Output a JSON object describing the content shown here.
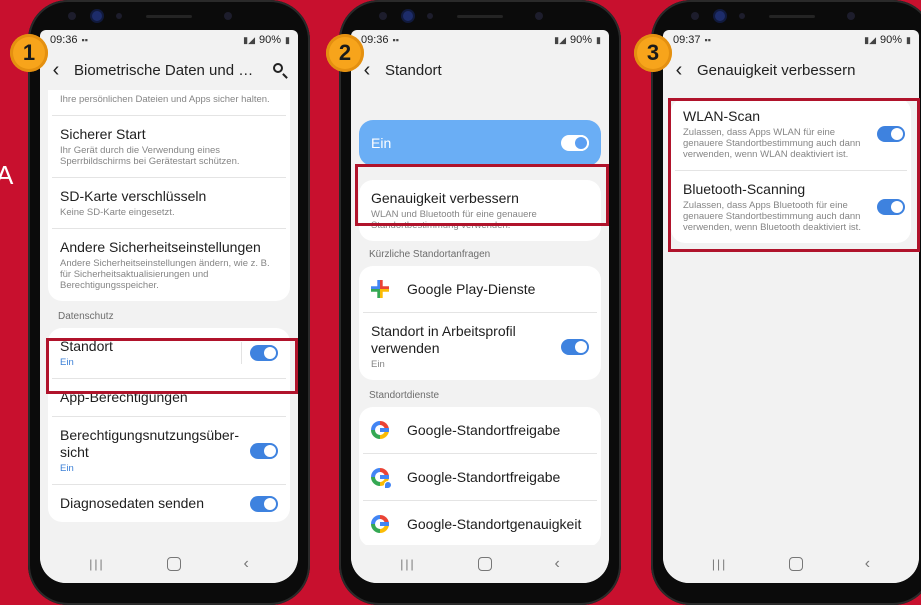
{
  "phones": [
    {
      "badge": "1",
      "status": {
        "time": "09:36",
        "battery": "90%"
      },
      "appbar": {
        "title": "Biometrische Daten und Sich…"
      },
      "partial_text": "Ihre persönlichen Dateien und Apps sicher halten.",
      "card1": [
        {
          "title": "Sicherer Start",
          "sub": "Ihr Gerät durch die Verwendung eines Sperrbildschirms bei Gerätestart schützen."
        },
        {
          "title": "SD-Karte verschlüsseln",
          "sub": "Keine SD-Karte eingesetzt."
        },
        {
          "title": "Andere Sicherheitseinstellungen",
          "sub": "Andere Sicherheitseinstellungen ändern, wie z. B. für Sicherheitsaktualisierungen und Berechtigungsspeicher."
        }
      ],
      "section": "Datenschutz",
      "card2": [
        {
          "title": "Standort",
          "sub": "Ein",
          "toggle": true
        },
        {
          "title": "App-Berechtigungen"
        },
        {
          "title": "Berechtigungsnutzungsüber-sicht",
          "sub": "Ein",
          "toggle": true
        },
        {
          "title": "Diagnosedaten senden",
          "toggle": true
        }
      ]
    },
    {
      "badge": "2",
      "status": {
        "time": "09:36",
        "battery": "90%"
      },
      "appbar": {
        "title": "Standort"
      },
      "main_toggle": {
        "label": "Ein"
      },
      "accuracy": {
        "title": "Genauigkeit verbessern",
        "sub": "WLAN und Bluetooth für eine genauere Standortbestimmung verwenden."
      },
      "section1": "Kürzliche Standortanfragen",
      "recent": [
        {
          "title": "Google Play-Dienste"
        },
        {
          "title": "Standort in Arbeitsprofil verwenden",
          "sub": "Ein",
          "toggle": true
        }
      ],
      "section2": "Standortdienste",
      "services": [
        {
          "title": "Google-Standortfreigabe"
        },
        {
          "title": "Google-Standortfreigabe"
        },
        {
          "title": "Google-Standortgenauigkeit"
        }
      ]
    },
    {
      "badge": "3",
      "status": {
        "time": "09:37",
        "battery": "90%"
      },
      "appbar": {
        "title": "Genauigkeit verbessern"
      },
      "items": [
        {
          "title": "WLAN-Scan",
          "sub": "Zulassen, dass Apps WLAN für eine genauere Standortbestimmung auch dann verwenden, wenn WLAN deaktiviert ist.",
          "toggle": true
        },
        {
          "title": "Bluetooth-Scanning",
          "sub": "Zulassen, dass Apps Bluetooth für eine genauere Standortbestimmung auch dann verwenden, wenn Bluetooth deaktiviert ist.",
          "toggle": true
        }
      ]
    }
  ],
  "colors": {
    "background": "#c8102e",
    "highlight": "#b0132b",
    "badge": "#f7a41b",
    "toggle_on": "#3e82df"
  },
  "icons": [
    "back-arrow-icon",
    "search-icon",
    "google-play-services-icon",
    "google-icon",
    "google-location-sharing-icon",
    "recents-icon",
    "home-icon",
    "back-icon"
  ]
}
